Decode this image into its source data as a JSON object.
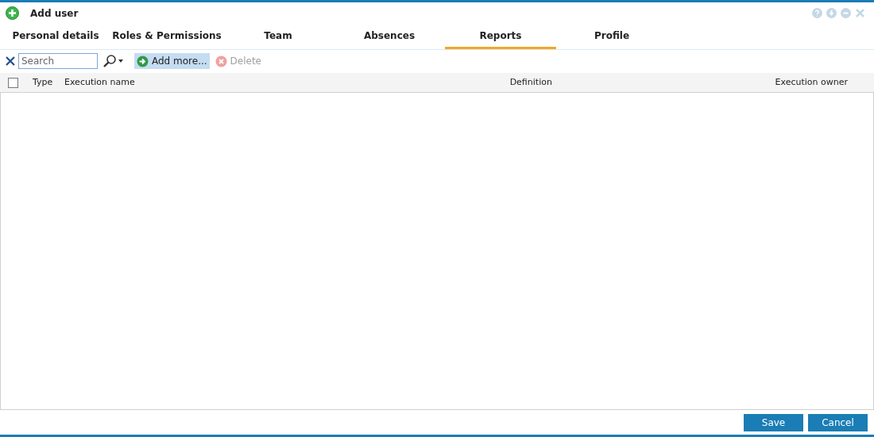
{
  "window": {
    "title": "Add user"
  },
  "tabs": [
    {
      "label": "Personal details",
      "selected": false
    },
    {
      "label": "Roles & Permissions",
      "selected": false
    },
    {
      "label": "Team",
      "selected": false
    },
    {
      "label": "Absences",
      "selected": false
    },
    {
      "label": "Reports",
      "selected": true
    },
    {
      "label": "Profile",
      "selected": false
    }
  ],
  "toolbar": {
    "search": {
      "placeholder": "Search"
    },
    "add_button": {
      "label": "Add more...",
      "hovered": true
    },
    "delete_button": {
      "label": "Delete",
      "disabled": true
    }
  },
  "table": {
    "select_all": {
      "checked": false
    },
    "columns": [
      "Type",
      "Execution name",
      "Definition",
      "Execution owner"
    ]
  },
  "buttons": [
    "Save",
    "Cancel"
  ]
}
